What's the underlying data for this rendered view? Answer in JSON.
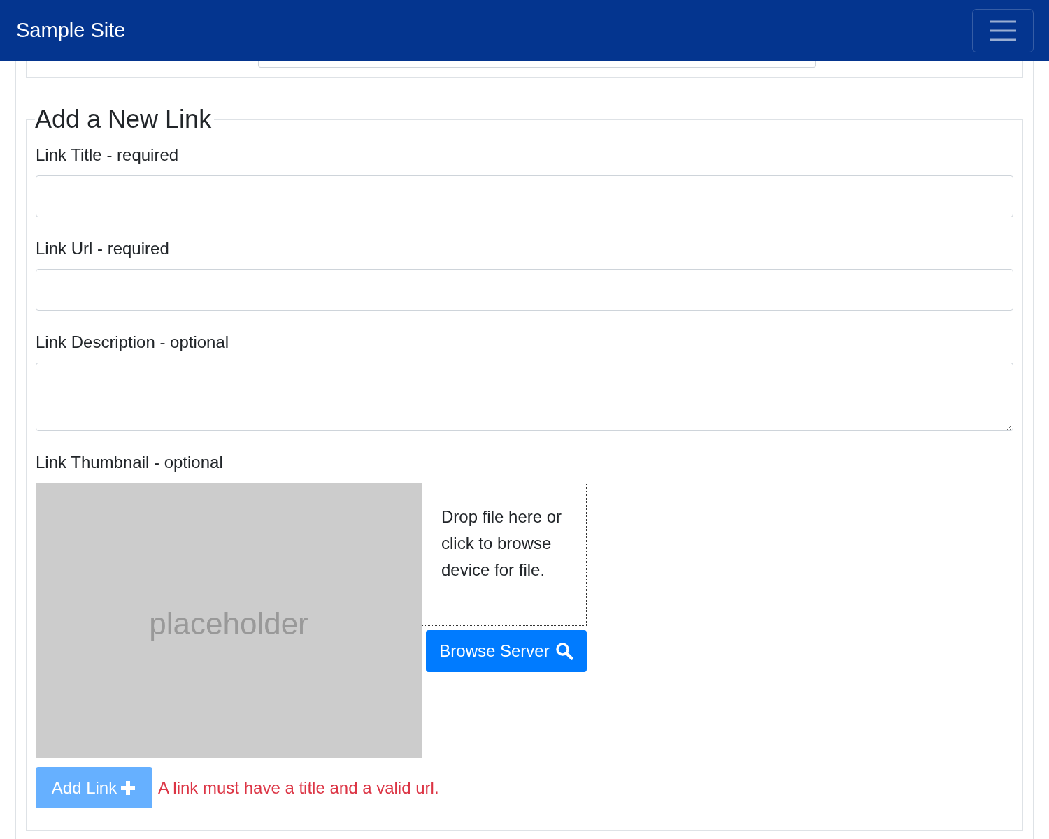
{
  "navbar": {
    "brand": "Sample Site",
    "menu_button": {
      "expanded": false
    }
  },
  "form": {
    "legend": "Add a New Link",
    "fields": [
      {
        "kind": "input",
        "label": "Link Title - required"
      },
      {
        "kind": "input",
        "label": "Link Url - required"
      },
      {
        "kind": "textarea",
        "label": "Link Description - optional"
      }
    ],
    "thumbnail": {
      "label": "Link Thumbnail - optional",
      "image_text": "placeholder",
      "dropzone_text": "Drop file here or click to browse device for file.",
      "browse_button": "Browse Server"
    },
    "submit": {
      "label": "Add Link",
      "disabled": true
    },
    "error": "A link must have a title and a valid url."
  }
}
